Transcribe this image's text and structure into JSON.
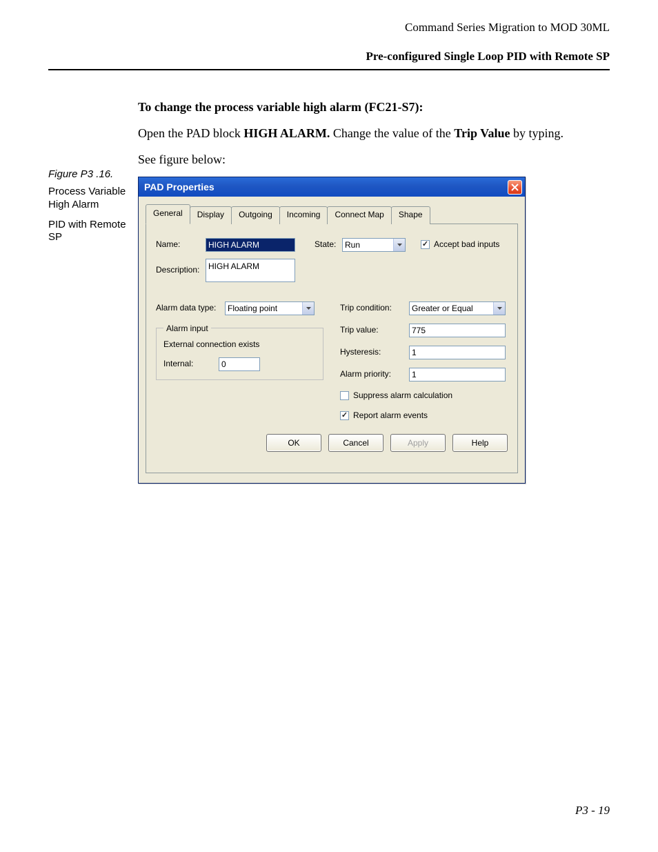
{
  "header": {
    "doc_title": "Command Series Migration to MOD 30ML",
    "section": "Pre-configured Single Loop PID with Remote SP"
  },
  "body": {
    "heading": "To change the process variable high alarm (FC21-S7):",
    "instr_pre": "Open the PAD block ",
    "instr_bold1": "HIGH ALARM.",
    "instr_mid": " Change the value of the ",
    "instr_bold2": "Trip Value",
    "instr_post": " by typing.",
    "see": "See figure below:"
  },
  "sidebar": {
    "figure": "Figure P3 .16.",
    "caption1": "Process Variable High Alarm",
    "caption2": "PID with Remote SP"
  },
  "dialog": {
    "title": "PAD Properties",
    "tabs": [
      "General",
      "Display",
      "Outgoing",
      "Incoming",
      "Connect Map",
      "Shape"
    ],
    "labels": {
      "name": "Name:",
      "state": "State:",
      "accept": "Accept bad inputs",
      "description": "Description:",
      "alarm_data_type": "Alarm data type:",
      "alarm_input": "Alarm input",
      "ext_conn": "External connection exists",
      "internal": "Internal:",
      "trip_condition": "Trip condition:",
      "trip_value": "Trip value:",
      "hysteresis": "Hysteresis:",
      "alarm_priority": "Alarm priority:",
      "suppress": "Suppress alarm calculation",
      "report": "Report alarm events"
    },
    "values": {
      "name": "HIGH ALARM",
      "state": "Run",
      "description": "HIGH ALARM",
      "alarm_data_type": "Floating point",
      "internal": "0",
      "trip_condition": "Greater or Equal",
      "trip_value": "775",
      "hysteresis": "1",
      "alarm_priority": "1",
      "accept_checked": true,
      "suppress_checked": false,
      "report_checked": true
    },
    "buttons": {
      "ok": "OK",
      "cancel": "Cancel",
      "apply": "Apply",
      "help": "Help"
    }
  },
  "footer": "P3 - 19"
}
